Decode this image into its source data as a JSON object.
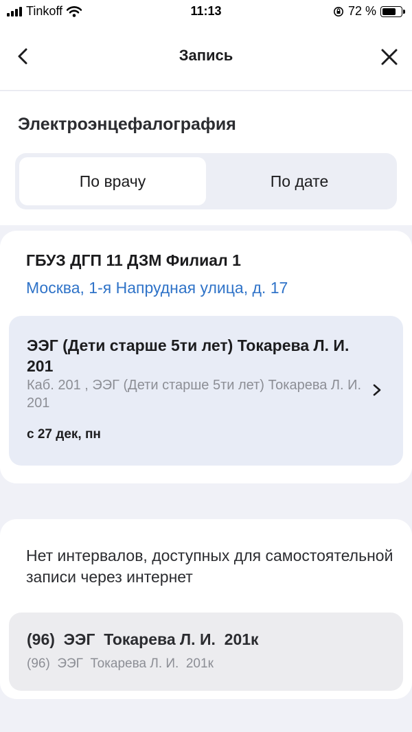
{
  "status_bar": {
    "carrier": "Tinkoff",
    "time": "11:13",
    "battery": "72 %",
    "battery_level": 0.72,
    "icons": [
      "signal-icon",
      "wifi-icon",
      "rotation-lock-icon",
      "battery-icon"
    ]
  },
  "nav": {
    "title": "Запись",
    "back_icon": "chevron-left-icon",
    "close_icon": "close-icon"
  },
  "header": {
    "service_title": "Электроэнцефалография",
    "tabs": [
      {
        "label": "По врачу",
        "selected": true
      },
      {
        "label": "По дате",
        "selected": false
      }
    ]
  },
  "clinic": {
    "name": "ГБУЗ ДГП 11 ДЗМ Филиал 1",
    "address": "Москва, 1-я Напрудная улица, д. 17",
    "doctor": {
      "name": "ЭЭГ (Дети старше 5ти лет) Токарева Л. И. 201",
      "subtitle": "Каб. 201 , ЭЭГ (Дети старше 5ти лет) Токарева Л. И. 201",
      "date": "с 27 дек, пн"
    }
  },
  "no_slots": {
    "message": "Нет интервалов, доступных для самостоятельной записи через интернет",
    "item": {
      "title": "(96)  ЭЭГ  Токарева Л. И.  201к",
      "subtitle": "(96)  ЭЭГ  Токарева Л. И.  201к"
    }
  },
  "colors": {
    "accent_link": "#2f73c8",
    "background": "#f0f1f7",
    "doctor_card": "#e8ecf6",
    "slot_card": "#ececef"
  }
}
